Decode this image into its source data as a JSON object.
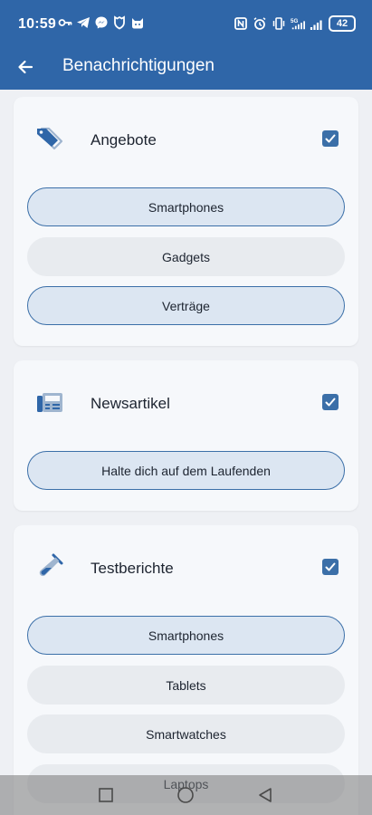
{
  "status_bar": {
    "time": "10:59",
    "battery": "42",
    "left_icons": [
      "key-icon",
      "telegram-icon",
      "messenger-icon",
      "shield-icon",
      "cat-icon"
    ],
    "right_icons": [
      "nfc-icon",
      "alarm-icon",
      "vibrate-icon",
      "signal-5g-icon",
      "signal-icon",
      "battery-icon"
    ]
  },
  "app_bar": {
    "title": "Benachrichtigungen",
    "back_icon": "arrow-back-icon"
  },
  "sections": [
    {
      "title": "Angebote",
      "icon": "tag-icon",
      "checked": true,
      "options": [
        {
          "label": "Smartphones",
          "selected": true
        },
        {
          "label": "Gadgets",
          "selected": false
        },
        {
          "label": "Verträge",
          "selected": true
        }
      ]
    },
    {
      "title": "Newsartikel",
      "icon": "newspaper-icon",
      "checked": true,
      "options": [
        {
          "label": "Halte dich auf dem Laufenden",
          "selected": true
        }
      ]
    },
    {
      "title": "Testberichte",
      "icon": "test-tube-icon",
      "checked": true,
      "options": [
        {
          "label": "Smartphones",
          "selected": true
        },
        {
          "label": "Tablets",
          "selected": false
        },
        {
          "label": "Smartwatches",
          "selected": false
        },
        {
          "label": "Laptops",
          "selected": false
        }
      ]
    }
  ],
  "colors": {
    "app_bar": "#2f66a8",
    "accent": "#3b6fa8",
    "selected_pill_bg": "#dce6f2",
    "unselected_pill_bg": "#e8ebef",
    "card_bg": "#f6f8fb",
    "page_bg": "#eef0f4"
  }
}
